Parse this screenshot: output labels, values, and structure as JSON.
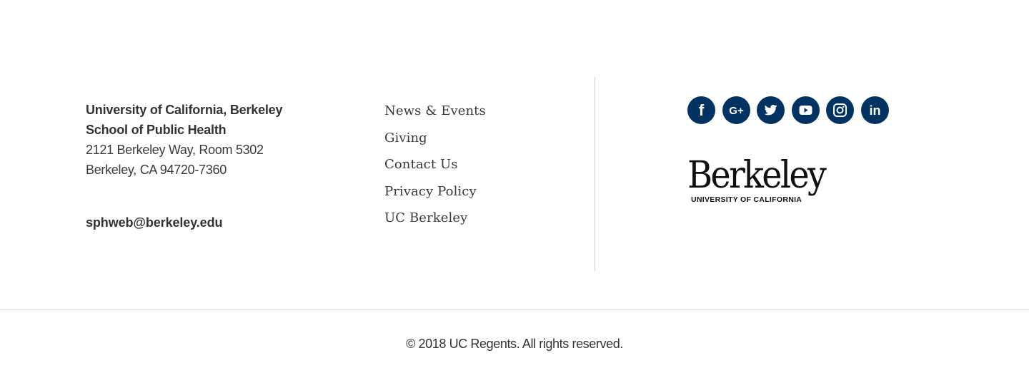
{
  "address": {
    "university": "University of California, Berkeley",
    "school": "School of Public Health",
    "street": "2121 Berkeley Way, Room 5302",
    "city": "Berkeley, CA 94720-7360",
    "email": "sphweb@berkeley.edu"
  },
  "links": [
    {
      "label": "News & Events"
    },
    {
      "label": "Giving"
    },
    {
      "label": "Contact Us"
    },
    {
      "label": "Privacy Policy"
    },
    {
      "label": "UC Berkeley"
    }
  ],
  "social": {
    "icon_color": "#003262",
    "items": [
      {
        "icon": "facebook-icon",
        "glyph": "f"
      },
      {
        "icon": "google-plus-icon",
        "glyph": "G+"
      },
      {
        "icon": "twitter-icon"
      },
      {
        "icon": "youtube-icon"
      },
      {
        "icon": "instagram-icon"
      },
      {
        "icon": "linkedin-icon",
        "glyph": "in"
      }
    ]
  },
  "logo": {
    "wordmark": "Berkeley",
    "subtitle": "UNIVERSITY OF CALIFORNIA"
  },
  "footer": {
    "copyright": "© 2018 UC Regents. All rights reserved."
  }
}
